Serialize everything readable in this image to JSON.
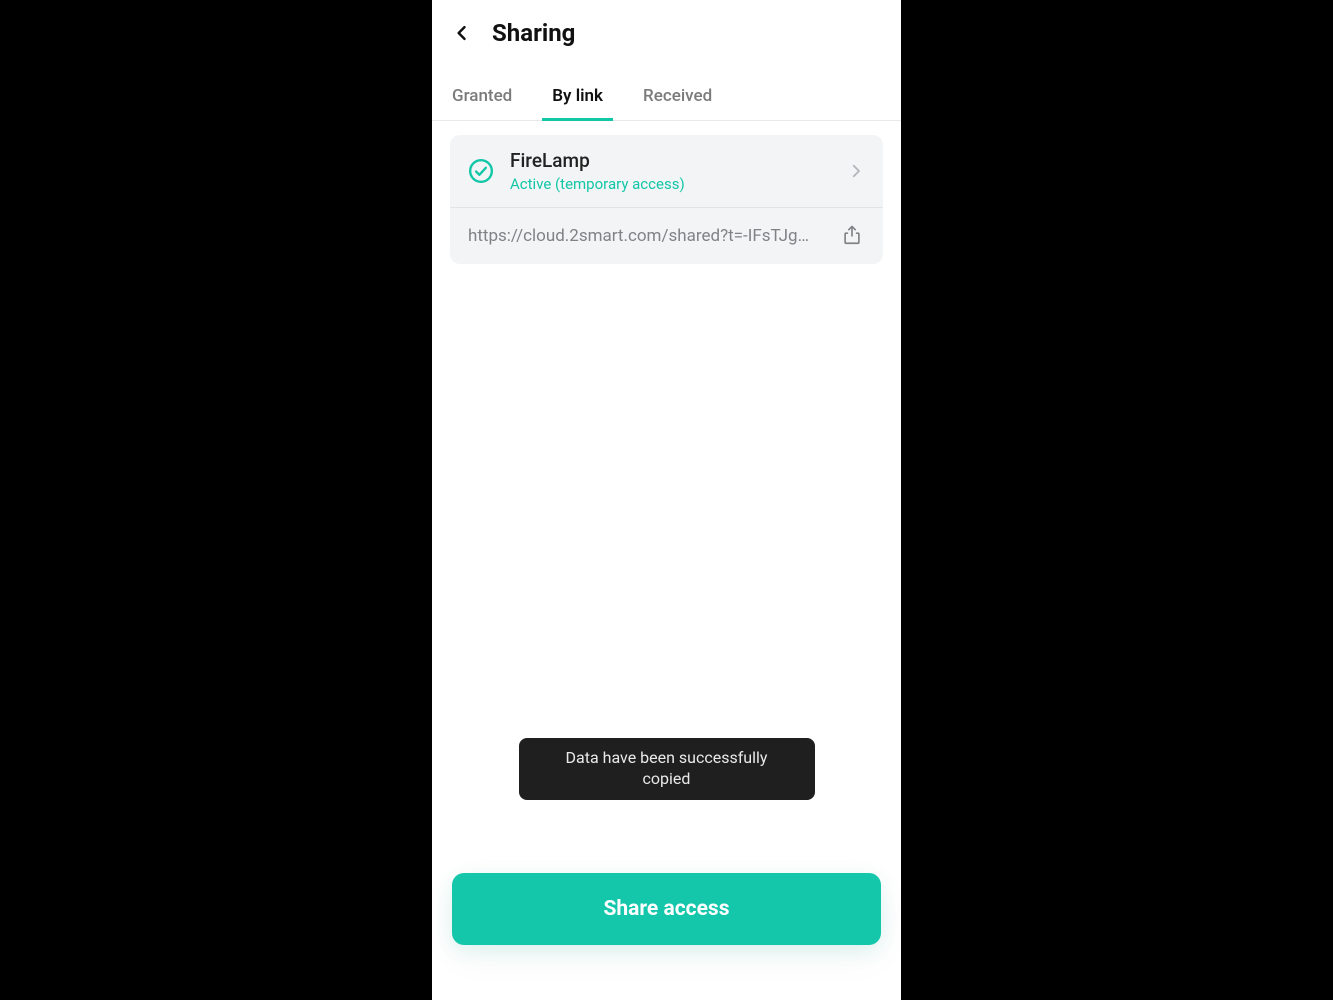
{
  "header": {
    "title": "Sharing"
  },
  "tabs": {
    "granted": "Granted",
    "by_link": "By link",
    "received": "Received"
  },
  "card": {
    "title": "FireLamp",
    "status": "Active (temporary access)",
    "link": "https://cloud.2smart.com/shared?t=-IFsTJg…"
  },
  "toast": {
    "message": "Data have been successfully copied"
  },
  "footer": {
    "button": "Share access"
  },
  "colors": {
    "accent": "#14c7ab"
  }
}
